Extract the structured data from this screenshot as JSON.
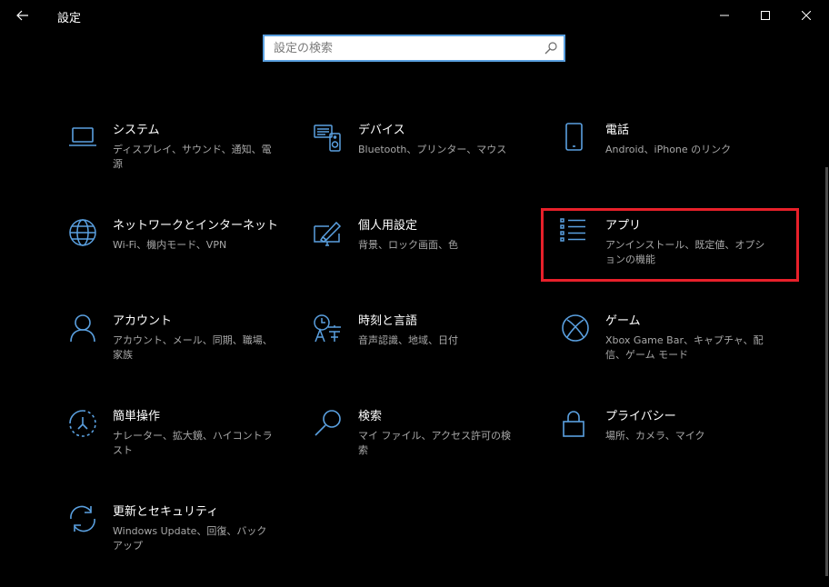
{
  "window": {
    "title": "設定",
    "back_icon": "arrow-left-icon",
    "controls": [
      "minimize-icon",
      "maximize-icon",
      "close-icon"
    ]
  },
  "search": {
    "placeholder": "設定の検索",
    "value": "",
    "icon": "search-icon"
  },
  "colors": {
    "background": "#000000",
    "accent_icon": "#5aa0e0",
    "highlight_border": "#e8202a",
    "description_text": "#a8a8a8"
  },
  "categories": [
    {
      "title": "システム",
      "description": "ディスプレイ、サウンド、通知、電源",
      "icon": "laptop-icon"
    },
    {
      "title": "デバイス",
      "description": "Bluetooth、プリンター、マウス",
      "icon": "devices-icon"
    },
    {
      "title": "電話",
      "description": "Android、iPhone のリンク",
      "icon": "phone-icon"
    },
    {
      "title": "ネットワークとインターネット",
      "description": "Wi-Fi、機内モード、VPN",
      "icon": "globe-icon"
    },
    {
      "title": "個人用設定",
      "description": "背景、ロック画面、色",
      "icon": "paint-monitor-icon"
    },
    {
      "title": "アプリ",
      "description": "アンインストール、既定値、オプションの機能",
      "icon": "apps-list-icon",
      "highlighted": true
    },
    {
      "title": "アカウント",
      "description": "アカウント、メール、同期、職場、家族",
      "icon": "person-icon"
    },
    {
      "title": "時刻と言語",
      "description": "音声認識、地域、日付",
      "icon": "time-language-icon"
    },
    {
      "title": "ゲーム",
      "description": "Xbox Game Bar、キャプチャ、配信、ゲーム モード",
      "icon": "xbox-icon"
    },
    {
      "title": "簡単操作",
      "description": "ナレーター、拡大鏡、ハイコントラスト",
      "icon": "ease-of-access-icon"
    },
    {
      "title": "検索",
      "description": "マイ ファイル、アクセス許可の検索",
      "icon": "search-magnifier-icon"
    },
    {
      "title": "プライバシー",
      "description": "場所、カメラ、マイク",
      "icon": "lock-icon"
    },
    {
      "title": "更新とセキュリティ",
      "description": "Windows Update、回復、バックアップ",
      "icon": "sync-icon"
    }
  ]
}
